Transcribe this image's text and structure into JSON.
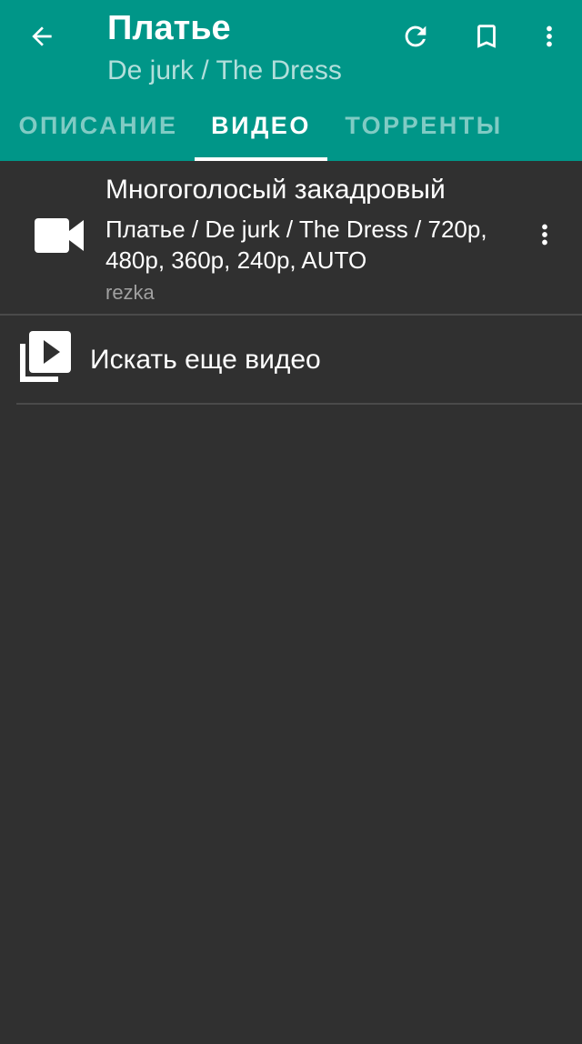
{
  "appbar": {
    "title": "Платье",
    "subtitle": "De jurk / The Dress",
    "color": "#009688"
  },
  "icons": {
    "back": "arrow-back-icon",
    "refresh": "refresh-icon",
    "bookmark": "bookmark-icon",
    "overflow": "more-vert-icon",
    "video": "videocam-icon",
    "library": "video-library-icon"
  },
  "tabs": [
    {
      "label": "ОПИСАНИЕ",
      "active": false
    },
    {
      "label": "ВИДЕО",
      "active": true
    },
    {
      "label": "ТОРРЕНТЫ",
      "active": false
    }
  ],
  "videos": [
    {
      "title": "Многоголосый закадровый",
      "description": "Платье / De jurk / The Dress / 720p, 480p, 360p, 240p, AUTO",
      "source": "rezka"
    }
  ],
  "search_more": {
    "label": "Искать еще видео"
  }
}
